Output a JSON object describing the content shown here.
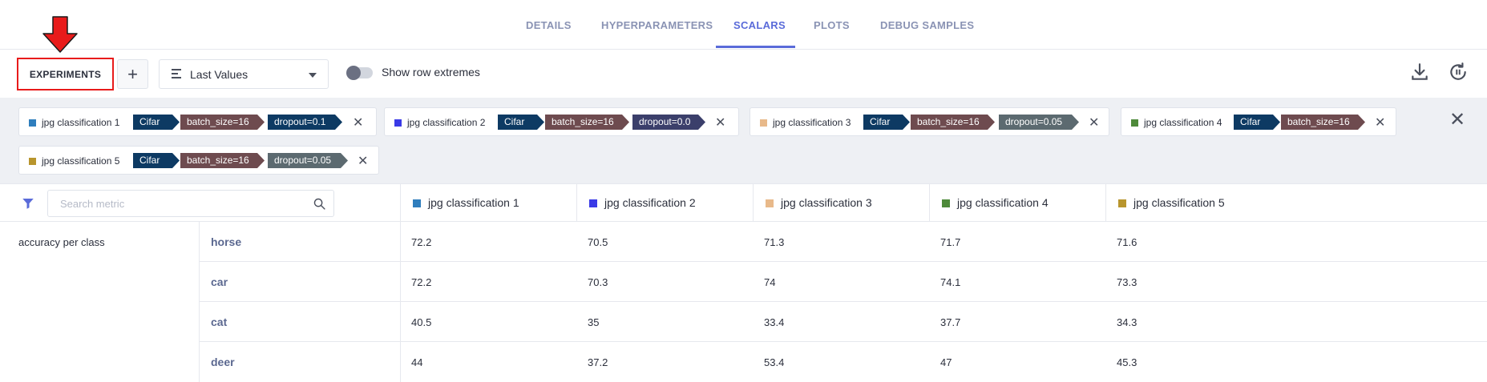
{
  "tabs": {
    "details": "DETAILS",
    "hyperparameters": "HYPERPARAMETERS",
    "scalars": "SCALARS",
    "plots": "PLOTS",
    "debug_samples": "DEBUG SAMPLES",
    "active": "SCALARS"
  },
  "toolbar": {
    "experiments_label": "EXPERIMENTS",
    "add_label": "+",
    "select_value": "Last Values",
    "toggle_label": "Show row extremes",
    "toggle_on": false
  },
  "colors": {
    "accent": "#5a6bd9",
    "highlight_border": "#e81b1b",
    "arrow": "#e81b1b",
    "tag_dataset": "#0d3a63",
    "tag_batch": "#6e4b4f",
    "tag_dropout_1": "#0d3a63",
    "tag_dropout_2": "#3b3f6b",
    "tag_dropout_3": "#5c6a70"
  },
  "experiments": [
    {
      "name": "jpg classification 1",
      "color": "#2f7ebd",
      "tags": [
        "Cifar",
        "batch_size=16",
        "dropout=0.1"
      ]
    },
    {
      "name": "jpg classification 2",
      "color": "#3a3ae6",
      "tags": [
        "Cifar",
        "batch_size=16",
        "dropout=0.0"
      ]
    },
    {
      "name": "jpg classification 3",
      "color": "#e8b98a",
      "tags": [
        "Cifar",
        "batch_size=16",
        "dropout=0.05"
      ]
    },
    {
      "name": "jpg classification 4",
      "color": "#4e8a3a",
      "tags": [
        "Cifar",
        "batch_size=16"
      ]
    },
    {
      "name": "jpg classification 5",
      "color": "#b8952d",
      "tags": [
        "Cifar",
        "batch_size=16",
        "dropout=0.05"
      ]
    }
  ],
  "table": {
    "search_placeholder": "Search metric",
    "group": "accuracy per class",
    "rows": [
      {
        "metric": "horse",
        "values": [
          "72.2",
          "70.5",
          "71.3",
          "71.7",
          "71.6"
        ]
      },
      {
        "metric": "car",
        "values": [
          "72.2",
          "70.3",
          "74",
          "74.1",
          "73.3"
        ]
      },
      {
        "metric": "cat",
        "values": [
          "40.5",
          "35",
          "33.4",
          "37.7",
          "34.3"
        ]
      },
      {
        "metric": "deer",
        "values": [
          "44",
          "37.2",
          "53.4",
          "47",
          "45.3"
        ]
      }
    ]
  },
  "icons": {
    "download": "download-icon",
    "refresh": "auto-refresh-icon",
    "close_all": "close-icon",
    "filter": "filter-icon",
    "search": "search-icon",
    "arrow": "arrow-down-icon"
  }
}
